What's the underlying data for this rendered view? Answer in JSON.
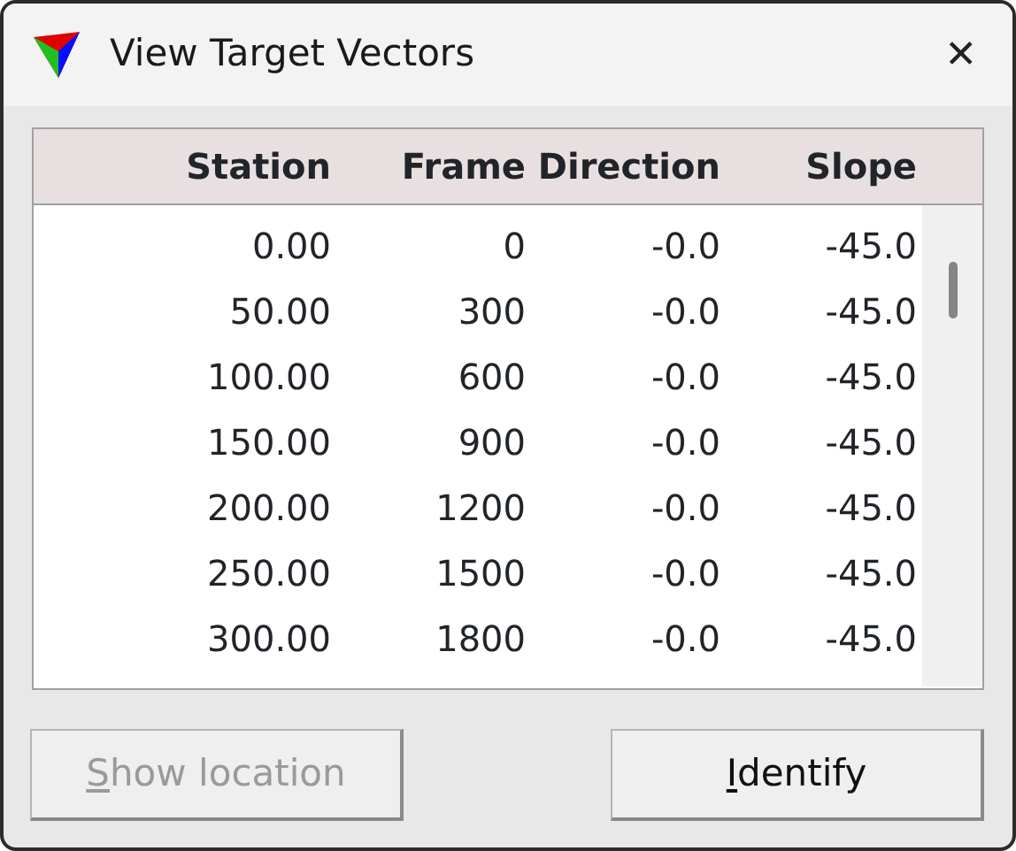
{
  "window": {
    "title": "View Target Vectors",
    "close": "✕"
  },
  "table": {
    "columns": [
      "Station",
      "Frame",
      "Direction",
      "Slope"
    ],
    "rows": [
      [
        "0.00",
        "0",
        "-0.0",
        "-45.0"
      ],
      [
        "50.00",
        "300",
        "-0.0",
        "-45.0"
      ],
      [
        "100.00",
        "600",
        "-0.0",
        "-45.0"
      ],
      [
        "150.00",
        "900",
        "-0.0",
        "-45.0"
      ],
      [
        "200.00",
        "1200",
        "-0.0",
        "-45.0"
      ],
      [
        "250.00",
        "1500",
        "-0.0",
        "-45.0"
      ],
      [
        "300.00",
        "1800",
        "-0.0",
        "-45.0"
      ]
    ]
  },
  "buttons": [
    {
      "access_key": "S",
      "rest": "how location",
      "disabled": true
    },
    {
      "access_key": "I",
      "rest": "dentify",
      "disabled": false
    }
  ]
}
